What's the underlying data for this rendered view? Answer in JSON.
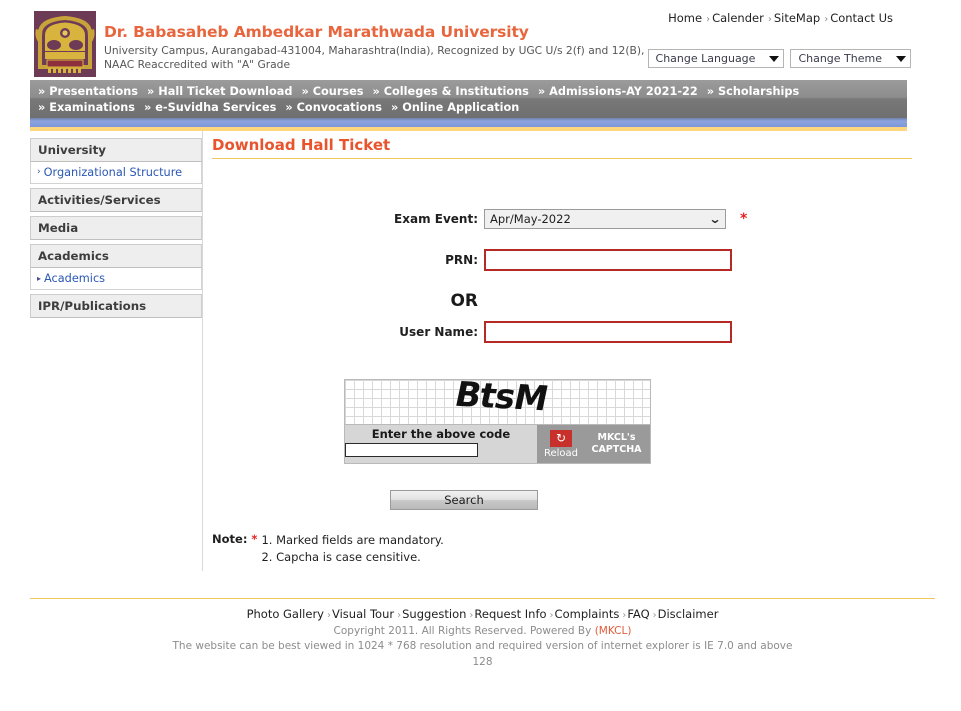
{
  "header": {
    "university_name": "Dr. Babasaheb Ambedkar Marathwada University",
    "subtitle": "University Campus, Aurangabad-431004, Maharashtra(India), Recognized by UGC U/s 2(f) and 12(B), NAAC Reaccredited with \"A\" Grade",
    "top_links": [
      {
        "label": "Home"
      },
      {
        "label": "Calender"
      },
      {
        "label": "SiteMap"
      },
      {
        "label": "Contact Us"
      }
    ],
    "selectors": [
      {
        "label": "Change Language"
      },
      {
        "label": "Change Theme"
      }
    ]
  },
  "nav": {
    "items": [
      {
        "label": "Presentations"
      },
      {
        "label": "Hall Ticket Download"
      },
      {
        "label": "Courses"
      },
      {
        "label": "Colleges & Institutions"
      },
      {
        "label": "Admissions-AY 2021-22"
      },
      {
        "label": "Scholarships"
      },
      {
        "label": "Examinations"
      },
      {
        "label": "e-Suvidha Services"
      },
      {
        "label": "Convocations"
      },
      {
        "label": "Online Application"
      }
    ],
    "bullet": "»"
  },
  "sidebar": {
    "groups": [
      {
        "heading": "University",
        "links": [
          {
            "label": "Organizational Structure",
            "arrow": "›"
          }
        ]
      },
      {
        "heading": "Activities/Services",
        "links": []
      },
      {
        "heading": "Media",
        "links": []
      },
      {
        "heading": "Academics",
        "links": [
          {
            "label": "Academics",
            "arrow": "▸"
          }
        ]
      },
      {
        "heading": "IPR/Publications",
        "links": []
      }
    ]
  },
  "main": {
    "page_title": "Download Hall Ticket",
    "fields": {
      "exam_event_label": "Exam Event:",
      "exam_event_value": "Apr/May-2022",
      "exam_event_options": [
        "Apr/May-2022"
      ],
      "required_mark": "*",
      "prn_label": "PRN:",
      "prn_value": "",
      "or_text": "OR",
      "username_label": "User Name:",
      "username_value": ""
    },
    "captcha": {
      "code": "BtsM",
      "prompt": "Enter the above code",
      "input_value": "",
      "reload_label": "Reload",
      "reload_icon": "↻",
      "brand_line1": "MKCL's",
      "brand_line2": "CAPTCHA"
    },
    "search_button": "Search",
    "note": {
      "label": "Note:",
      "star": "*",
      "line1": "1. Marked fields are mandatory.",
      "line2": "2. Capcha is case censitive."
    }
  },
  "footer": {
    "links": [
      {
        "label": "Photo Gallery"
      },
      {
        "label": "Visual Tour"
      },
      {
        "label": "Suggestion"
      },
      {
        "label": "Request Info"
      },
      {
        "label": "Complaints"
      },
      {
        "label": "FAQ"
      },
      {
        "label": "Disclaimer"
      }
    ],
    "copyright_prefix": "Copyright 2011. All Rights Reserved. Powered By ",
    "copyright_mkcl": "(MKCL)",
    "browser_note": "The website can be best viewed in 1024 * 768 resolution and required version of internet explorer is IE 7.0 and above",
    "counter": "128"
  },
  "colors": {
    "brand_orange": "#e8663d",
    "title_orange": "#e8542d",
    "gold_rule": "#f0c75e",
    "nav_gray": "#8d8d8d",
    "nav_blue": "#8ba4df",
    "input_red": "#b52a24",
    "reload_red": "#c7302b",
    "link_blue": "#2a58b4"
  }
}
